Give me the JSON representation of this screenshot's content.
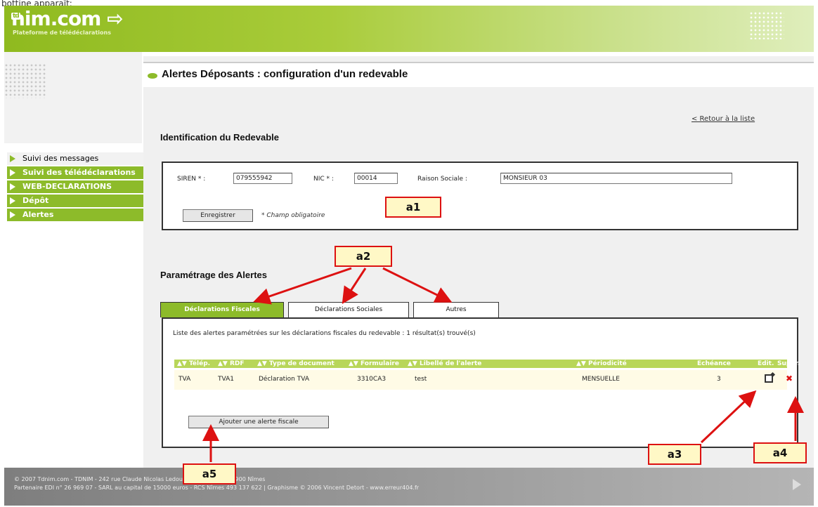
{
  "top_fragment": "bottine apparaît:",
  "brand": {
    "logo_td": "td",
    "logo_rest": "nim.com",
    "tagline": "Plateforme de télédéclarations"
  },
  "page_title": "Alertes Déposants : configuration d'un redevable",
  "sidebar": {
    "items": [
      {
        "label": "Suivi des messages",
        "active": true
      },
      {
        "label": "Suivi des télédéclarations"
      },
      {
        "label": "WEB-DECLARATIONS"
      },
      {
        "label": "Dépôt"
      },
      {
        "label": "Alertes"
      }
    ]
  },
  "back_link": "< Retour à la liste",
  "identification": {
    "heading": "Identification du Redevable",
    "siren_label": "SIREN * :",
    "siren_value": "079555942",
    "nic_label": "NIC * :",
    "nic_value": "00014",
    "raison_label": "Raison Sociale :",
    "raison_value": "MONSIEUR 03",
    "save_button": "Enregistrer",
    "required_note": "* Champ obligatoire"
  },
  "alerts": {
    "heading": "Paramétrage des Alertes",
    "tabs": [
      {
        "label": "Déclarations Fiscales",
        "active": true
      },
      {
        "label": "Déclarations Sociales"
      },
      {
        "label": "Autres"
      }
    ],
    "list_text": "Liste des alertes paramétrées sur les déclarations fiscales du redevable : 1 résultat(s) trouvé(s)",
    "columns": [
      "Télép.",
      "RDF",
      "Type de document",
      "Formulaire",
      "Libellé de l'alerte",
      "Périodicité",
      "Echéance",
      "Edit.",
      "Suppr."
    ],
    "rows": [
      {
        "telep": "TVA",
        "rdf": "TVA1",
        "type": "Déclaration TVA",
        "formulaire": "3310CA3",
        "libelle": "test",
        "periodicite": "MENSUELLE",
        "echeance": "3"
      }
    ],
    "add_button": "Ajouter une alerte fiscale"
  },
  "callouts": {
    "a1": "a1",
    "a2": "a2",
    "a3": "a3",
    "a4": "a4",
    "a5": "a5"
  },
  "footer": {
    "line1": "© 2007 Tdnim.com - TDNIM - 242 rue Claude Nicolas Ledoux - Ville active - 30900 Nîmes",
    "line2": "Partenaire EDI n° 26 969 07 - SARL au capital de 15000 euros - RCS Nîmes 493 137 622 | Graphisme © 2006 Vincent Detort - www.erreur404.fr"
  },
  "colors": {
    "brand_green": "#8dbb2a",
    "callout_border": "#dd1111",
    "callout_fill": "#fff8c6"
  }
}
